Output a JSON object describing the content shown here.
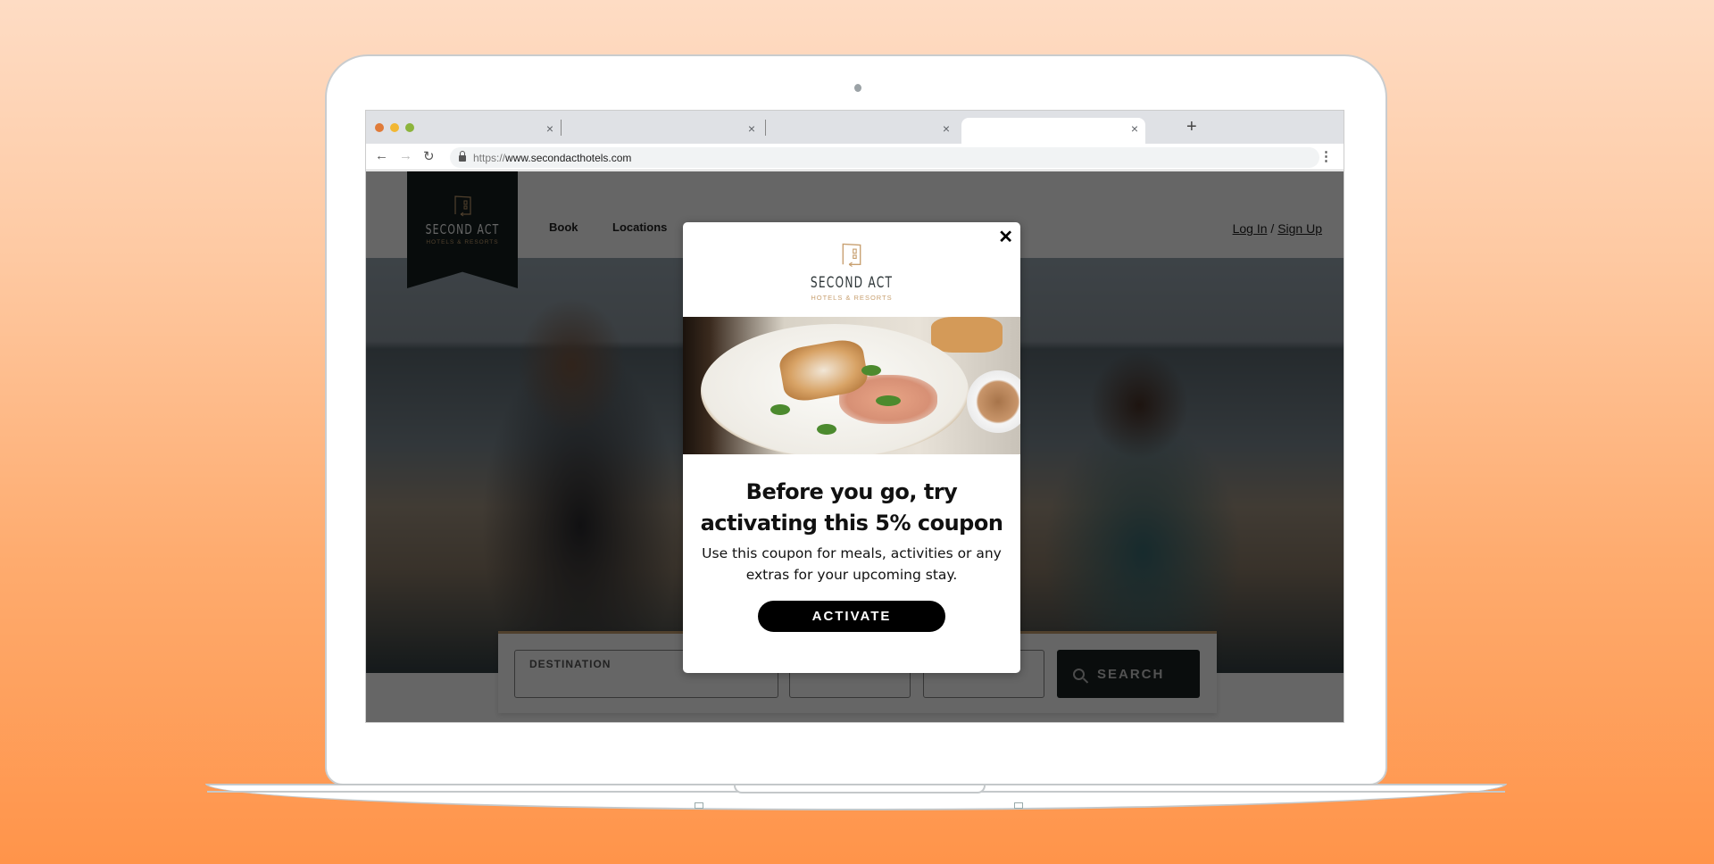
{
  "browser": {
    "tabs": [
      {
        "label": "",
        "active": false,
        "close": "×"
      },
      {
        "label": "",
        "active": false,
        "close": "×"
      },
      {
        "label": "",
        "active": false,
        "close": "×"
      },
      {
        "label": "",
        "active": true,
        "close": "×"
      }
    ],
    "new_tab": "+",
    "back": "←",
    "forward": "→",
    "reload": "↻",
    "url_scheme": "https://",
    "url_host": "www.secondacthotels.com",
    "menu": "⋮",
    "traffic_colors": [
      "#e07b39",
      "#f2b733",
      "#8cb43c"
    ]
  },
  "site": {
    "logo": {
      "name": "SECOND ACT",
      "tagline": "HOTELS & RESORTS",
      "accent": "#c8a070",
      "banner_color": "#142020"
    },
    "nav": [
      {
        "label": "Book"
      },
      {
        "label": "Locations"
      }
    ],
    "auth": {
      "login": "Log In",
      "separator": " / ",
      "signup": "Sign Up"
    },
    "search": {
      "fields": [
        {
          "label": "DESTINATION",
          "value": ""
        },
        {
          "label": "",
          "value": ""
        },
        {
          "label": "",
          "value": ""
        }
      ],
      "button": "SEARCH"
    }
  },
  "modal": {
    "close": "✕",
    "logo": {
      "name": "SECOND ACT",
      "tagline": "HOTELS & RESORTS"
    },
    "title": "Before you go, try activating this 5% coupon",
    "description": "Use this coupon for meals, activities or any extras for your upcoming stay.",
    "button": "ACTIVATE"
  }
}
